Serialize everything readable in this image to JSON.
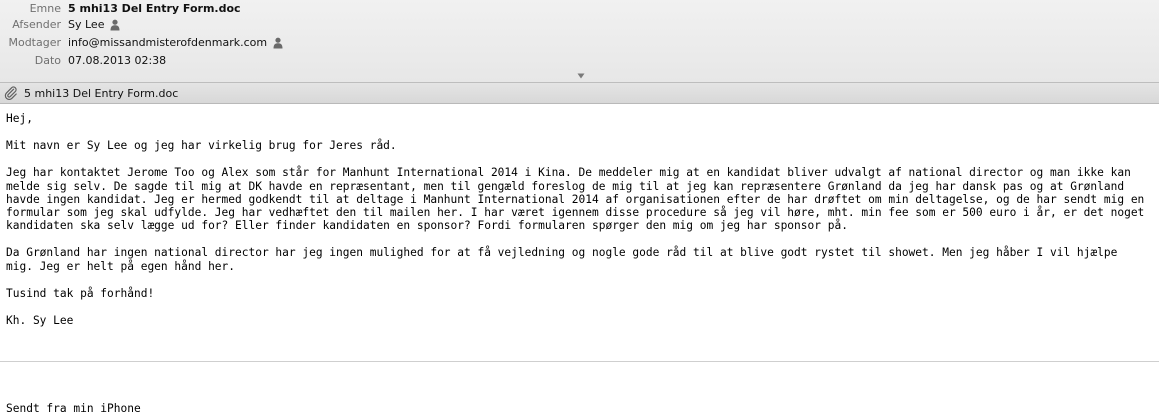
{
  "header": {
    "subject_label": "Emne",
    "subject": "5 mhi13 Del Entry Form.doc",
    "from_label": "Afsender",
    "from": "Sy Lee",
    "to_label": "Modtager",
    "to": "info@missandmisterofdenmark.com",
    "date_label": "Dato",
    "date": "07.08.2013 02:38"
  },
  "attachment": {
    "name": "5 mhi13 Del Entry Form.doc"
  },
  "message": {
    "greeting": "Hej,",
    "p1": "Mit navn er Sy Lee og jeg har virkelig brug for Jeres råd.",
    "p2": "Jeg har kontaktet Jerome Too og Alex som står for Manhunt International 2014 i Kina. De meddeler mig at en kandidat bliver udvalgt af national director og man ikke kan melde sig selv. De sagde til mig at DK havde en repræsentant, men til gengæld foreslog de mig til at jeg kan repræsentere Grønland da jeg har dansk pas og at Grønland havde ingen kandidat. Jeg er hermed godkendt til at deltage i Manhunt International 2014 af organisationen efter de har drøftet om min deltagelse, og de har sendt mig en formular som jeg skal udfylde. Jeg har vedhæftet den til mailen her. I har været igennem disse procedure så jeg vil høre, mht. min fee som er 500 euro i år, er det noget kandidaten ska selv lægge ud for? Eller finder kandidaten en sponsor? Fordi formularen spørger den mig om jeg har sponsor på.",
    "p3": "Da Grønland har ingen national director har jeg ingen mulighed for at få vejledning og nogle gode råd til at blive godt rystet til showet. Men jeg håber I vil hjælpe mig. Jeg er helt på egen hånd her.",
    "thanks": "Tusind tak på forhånd!",
    "closing": "Kh. Sy Lee",
    "signature": "Sendt fra min iPhone"
  }
}
